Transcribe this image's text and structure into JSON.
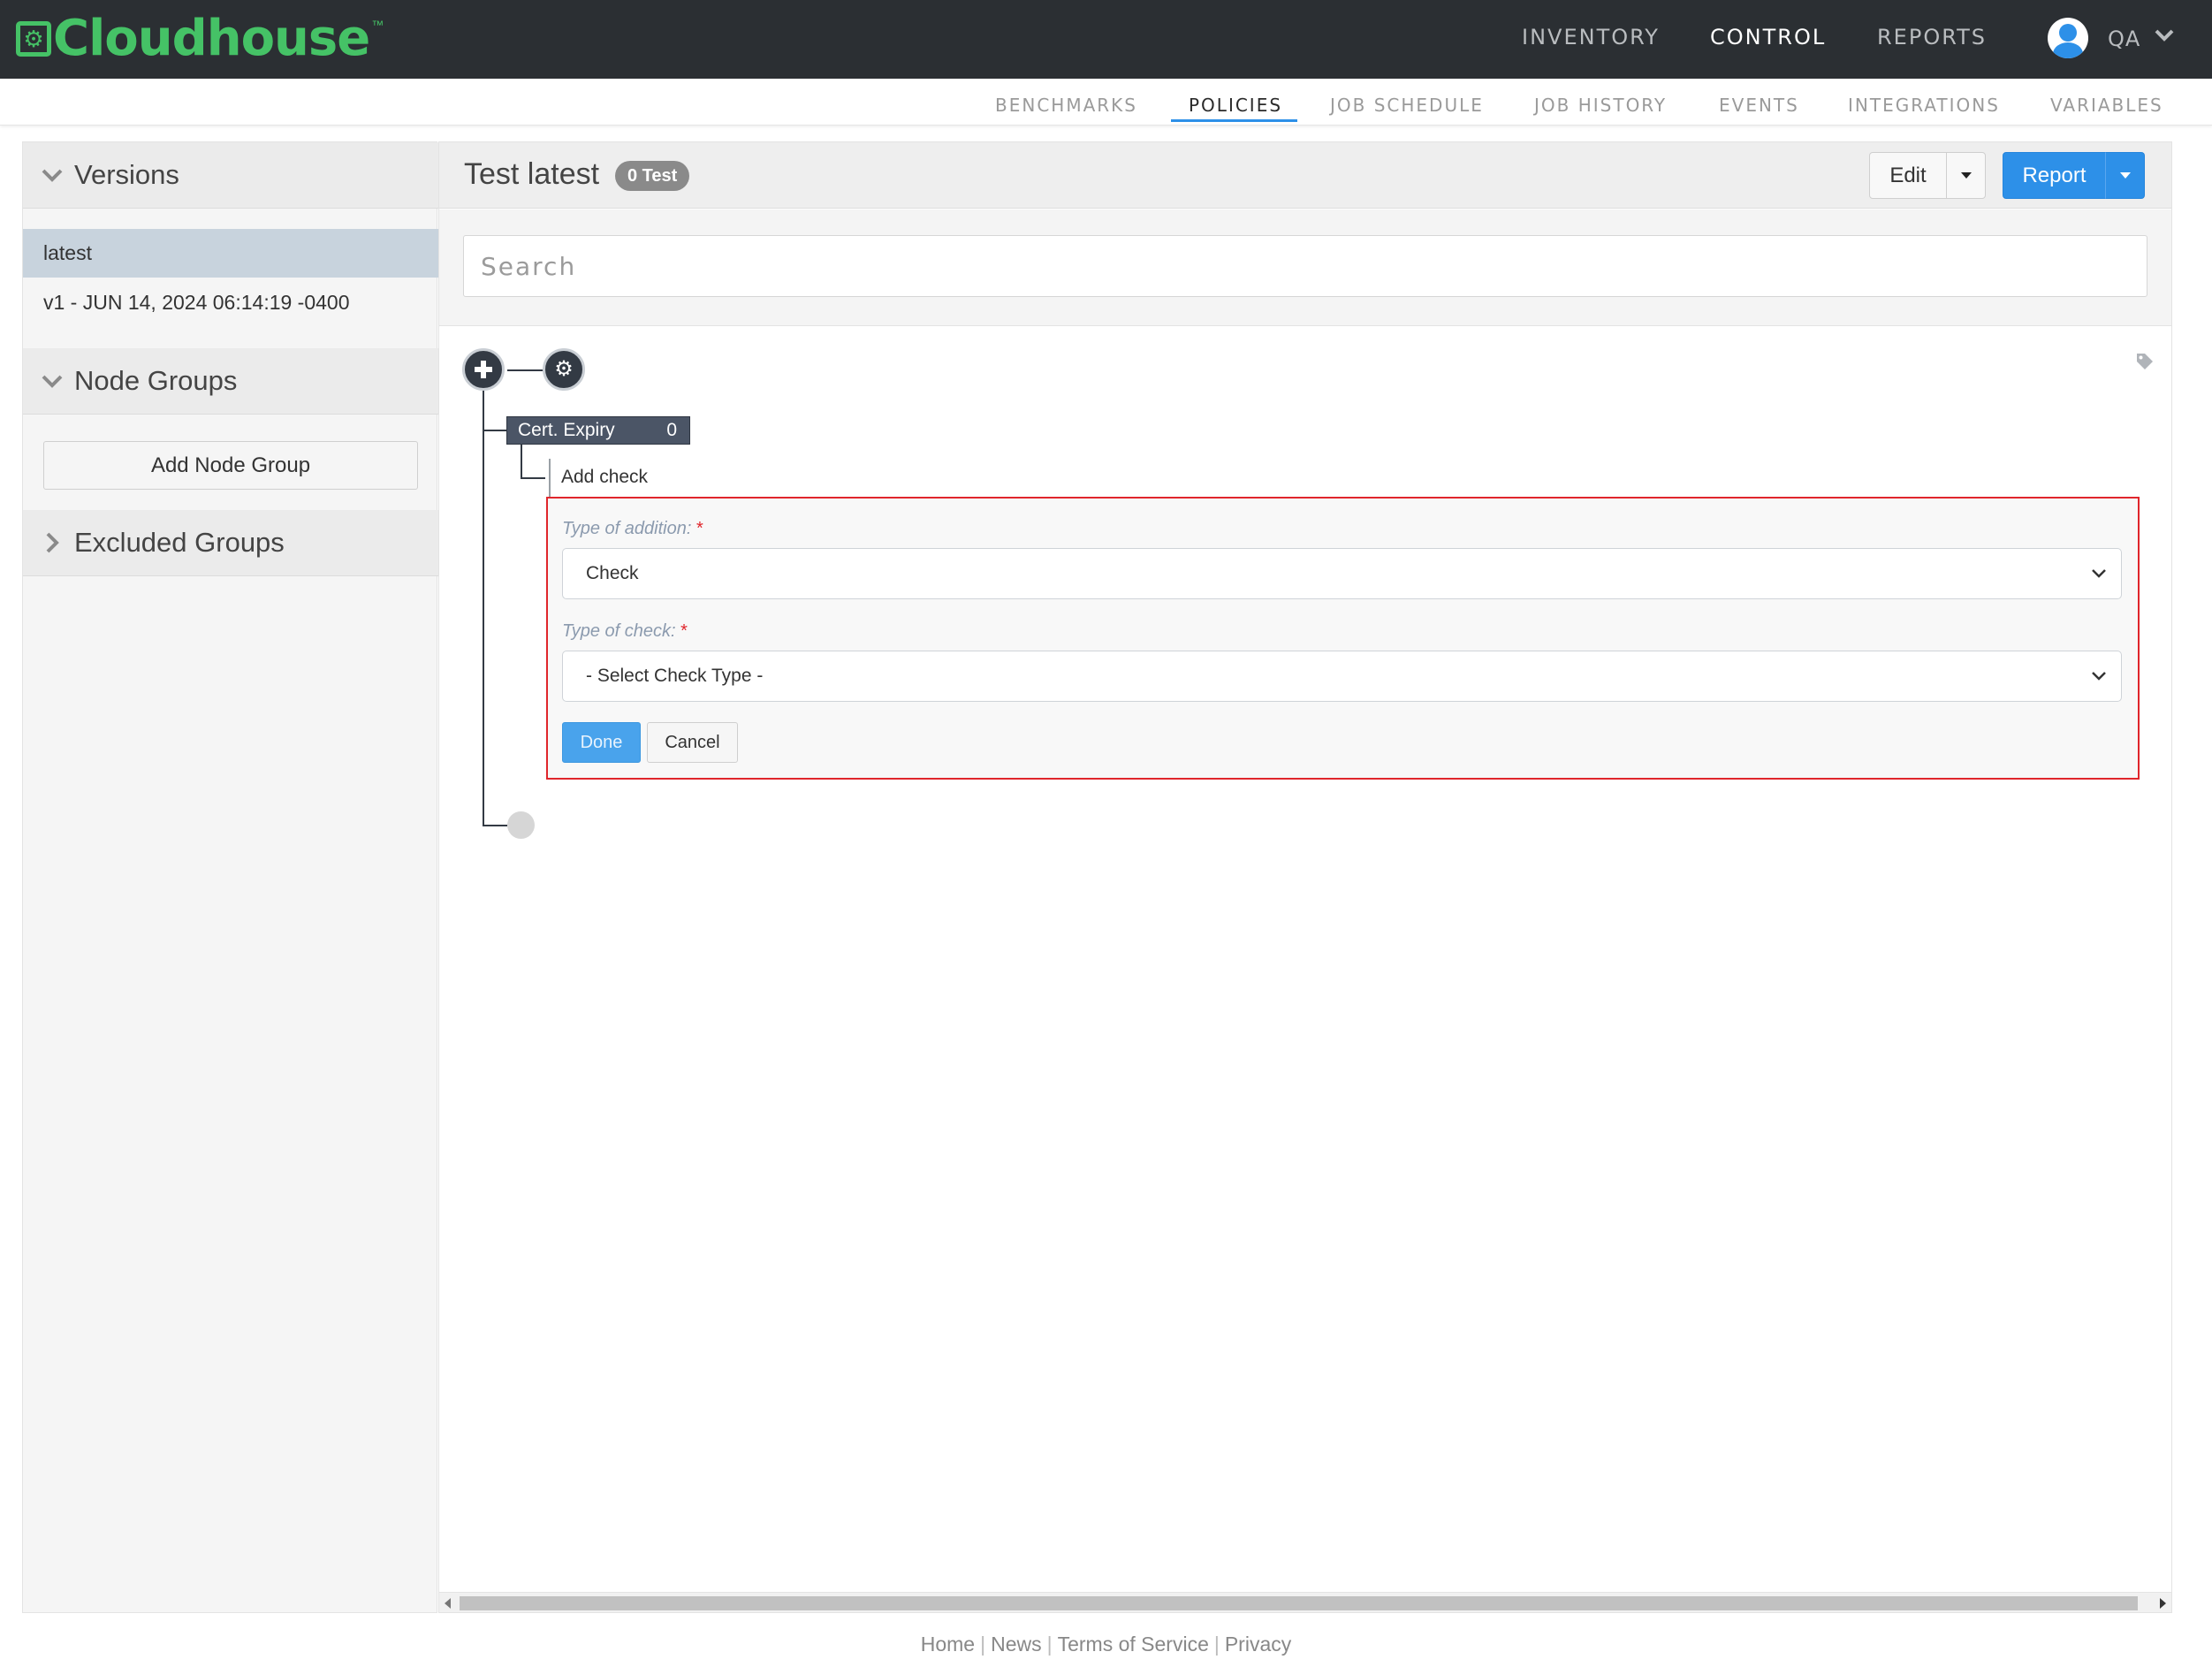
{
  "app": {
    "logo_text": "Cloudhouse",
    "logo_tm": "™",
    "brand_color": "#45c266"
  },
  "top_nav": {
    "items": [
      {
        "label": "INVENTORY"
      },
      {
        "label": "CONTROL",
        "active": true
      },
      {
        "label": "REPORTS"
      }
    ],
    "user": {
      "name": "QA",
      "icon": "user-avatar-icon"
    }
  },
  "sub_nav": {
    "items": [
      {
        "label": "BENCHMARKS"
      },
      {
        "label": "POLICIES",
        "active": true
      },
      {
        "label": "JOB SCHEDULE"
      },
      {
        "label": "JOB HISTORY"
      },
      {
        "label": "EVENTS"
      },
      {
        "label": "INTEGRATIONS"
      },
      {
        "label": "VARIABLES"
      }
    ]
  },
  "sidebar": {
    "versions_title": "Versions",
    "versions": [
      {
        "label": "latest",
        "selected": true
      },
      {
        "label": "v1 - JUN 14, 2024 06:14:19 -0400"
      }
    ],
    "node_groups_title": "Node Groups",
    "add_node_group_label": "Add Node Group",
    "excluded_groups_title": "Excluded Groups"
  },
  "main": {
    "title": "Test latest",
    "badge": "0 Test",
    "edit_label": "Edit",
    "report_label": "Report",
    "search_placeholder": "Search",
    "accent_color": "#2d90e8"
  },
  "tree": {
    "group": {
      "name": "Cert. Expiry",
      "count": "0"
    },
    "add_check_label": "Add check"
  },
  "form": {
    "type_of_addition_label": "Type of addition:",
    "type_of_addition_value": "Check",
    "type_of_check_label": "Type of check:",
    "type_of_check_value": "- Select Check Type -",
    "required_mark": "*",
    "done_label": "Done",
    "cancel_label": "Cancel",
    "highlight_color": "#e0262c"
  },
  "footer": {
    "links": [
      "Home",
      "News",
      "Terms of Service",
      "Privacy"
    ],
    "separator": "|"
  }
}
